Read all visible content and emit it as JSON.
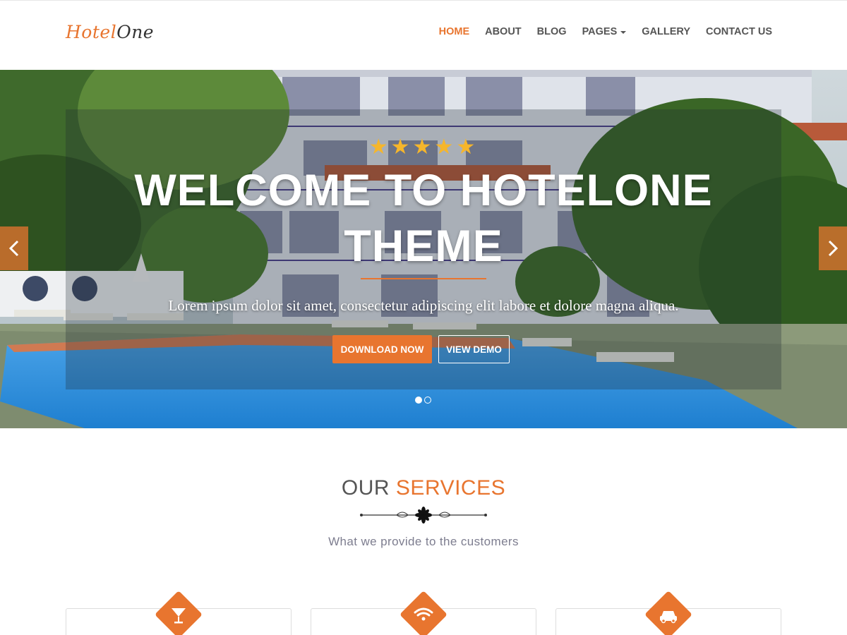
{
  "brand": {
    "logo_part1": "Hotel",
    "logo_part2": "One"
  },
  "nav": {
    "items": [
      {
        "label": "HOME",
        "active": true
      },
      {
        "label": "ABOUT"
      },
      {
        "label": "BLOG"
      },
      {
        "label": "PAGES",
        "has_dropdown": true
      },
      {
        "label": "GALLERY"
      },
      {
        "label": "CONTACT US"
      }
    ]
  },
  "hero": {
    "stars": "★★★★★",
    "rating": 5,
    "title": "WELCOME TO HOTELONE THEME",
    "subtitle": "Lorem ipsum dolor sit amet, consectetur adipiscing elit labore et dolore magna aliqua.",
    "primary_button": "DOWNLOAD NOW",
    "secondary_button": "VIEW DEMO",
    "slide_count": 2,
    "active_slide": 1
  },
  "services": {
    "title_part1": "OUR",
    "title_part2": "SERVICES",
    "subtitle": "What we provide to the customers",
    "cards": [
      {
        "icon": "cocktail-icon"
      },
      {
        "icon": "wifi-icon"
      },
      {
        "icon": "car-icon"
      }
    ]
  },
  "colors": {
    "accent": "#e8752f",
    "star": "#f6b62b",
    "text": "#555555"
  }
}
